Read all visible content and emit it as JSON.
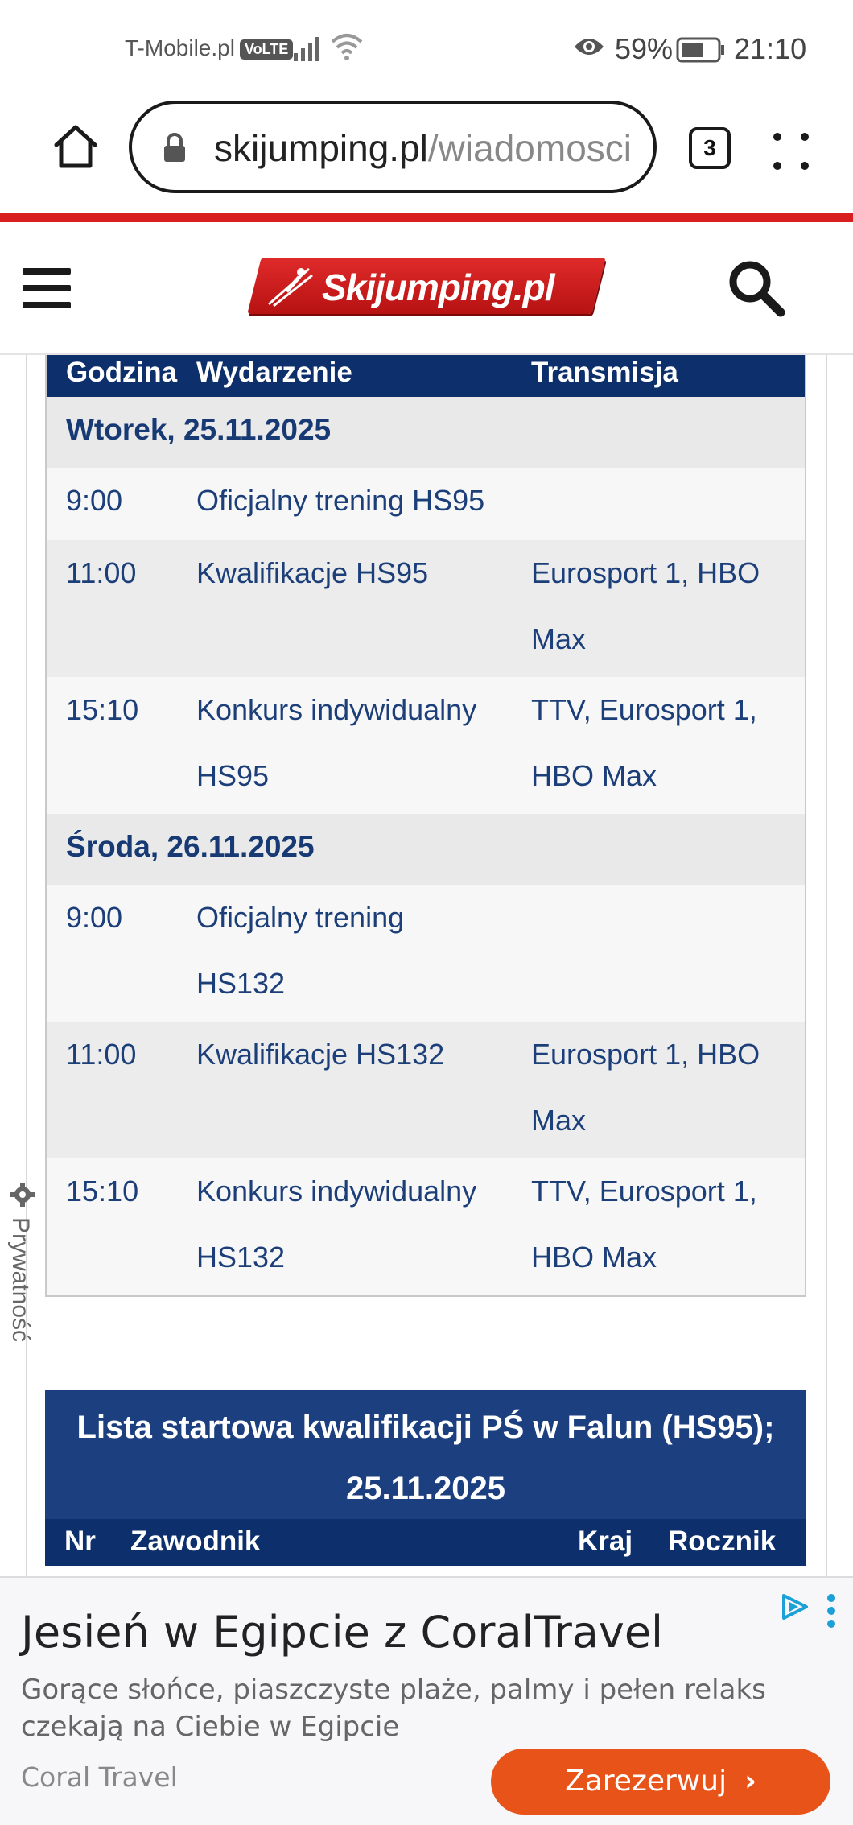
{
  "status_bar": {
    "carrier": "T-Mobile.pl",
    "volte": "VoLTE",
    "battery": "59%",
    "time": "21:10"
  },
  "browser": {
    "url_domain": "skijumping.pl",
    "url_path": "/wiadomosci",
    "tab_count": "3"
  },
  "site": {
    "logo_text": "Skijumping.pl",
    "privacy_label": "Prywatność"
  },
  "schedule": {
    "headers": [
      "Godzina",
      "Wydarzenie",
      "Transmisja"
    ],
    "days": [
      {
        "label": "Wtorek, 25.11.2025",
        "events": [
          {
            "time": "9:00",
            "event": "Oficjalny trening HS95",
            "tv": ""
          },
          {
            "time": "11:00",
            "event": "Kwalifikacje HS95",
            "tv": "Eurosport 1, HBO Max"
          },
          {
            "time": "15:10",
            "event": "Konkurs indywidualny HS95",
            "tv": "TTV, Eurosport 1, HBO Max"
          }
        ]
      },
      {
        "label": "Środa, 26.11.2025",
        "events": [
          {
            "time": "9:00",
            "event": "Oficjalny trening HS132",
            "tv": ""
          },
          {
            "time": "11:00",
            "event": "Kwalifikacje HS132",
            "tv": "Eurosport 1, HBO Max"
          },
          {
            "time": "15:10",
            "event": "Konkurs indywidualny HS132",
            "tv": "TTV, Eurosport 1, HBO Max"
          }
        ]
      }
    ]
  },
  "start_list": {
    "title": "Lista startowa kwalifikacji PŚ w Falun (HS95); 25.11.2025",
    "headers": [
      "Nr",
      "Zawodnik",
      "Kraj",
      "Rocznik"
    ]
  },
  "ad": {
    "title": "Jesień w Egipcie z CoralTravel",
    "description": "Gorące słońce, piaszczyste plaże, palmy i pełen relaks czekają na Ciebie w Egipcie",
    "brand": "Coral Travel",
    "cta": "Zarezerwuj"
  },
  "colors": {
    "accent_red": "#d81e1e",
    "table_header": "#0d2f6b",
    "table_text": "#1c3f7a",
    "cta_orange": "#e8531a"
  }
}
